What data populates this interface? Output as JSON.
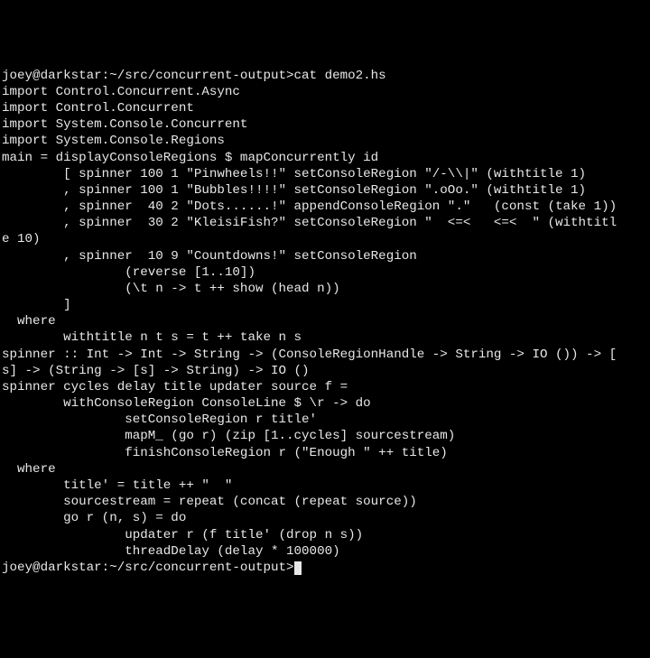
{
  "terminal": {
    "lines": [
      "joey@darkstar:~/src/concurrent-output>cat demo2.hs",
      "import Control.Concurrent.Async",
      "import Control.Concurrent",
      "import System.Console.Concurrent",
      "import System.Console.Regions",
      "",
      "main = displayConsoleRegions $ mapConcurrently id",
      "        [ spinner 100 1 \"Pinwheels!!\" setConsoleRegion \"/-\\\\|\" (withtitle 1)",
      "        , spinner 100 1 \"Bubbles!!!!\" setConsoleRegion \".oOo.\" (withtitle 1)",
      "        , spinner  40 2 \"Dots......!\" appendConsoleRegion \".\"   (const (take 1))",
      "        , spinner  30 2 \"KleisiFish?\" setConsoleRegion \"  <=<   <=<  \" (withtitl",
      "e 10)",
      "        , spinner  10 9 \"Countdowns!\" setConsoleRegion",
      "                (reverse [1..10])",
      "                (\\t n -> t ++ show (head n))",
      "        ]",
      "  where",
      "        withtitle n t s = t ++ take n s",
      "",
      "spinner :: Int -> Int -> String -> (ConsoleRegionHandle -> String -> IO ()) -> [",
      "s] -> (String -> [s] -> String) -> IO ()",
      "spinner cycles delay title updater source f =",
      "        withConsoleRegion ConsoleLine $ \\r -> do",
      "                setConsoleRegion r title'",
      "                mapM_ (go r) (zip [1..cycles] sourcestream)",
      "                finishConsoleRegion r (\"Enough \" ++ title)",
      "  where",
      "        title' = title ++ \"  \"",
      "        sourcestream = repeat (concat (repeat source))",
      "        go r (n, s) = do",
      "                updater r (f title' (drop n s))",
      "                threadDelay (delay * 100000)"
    ],
    "prompt2": "joey@darkstar:~/src/concurrent-output>"
  }
}
